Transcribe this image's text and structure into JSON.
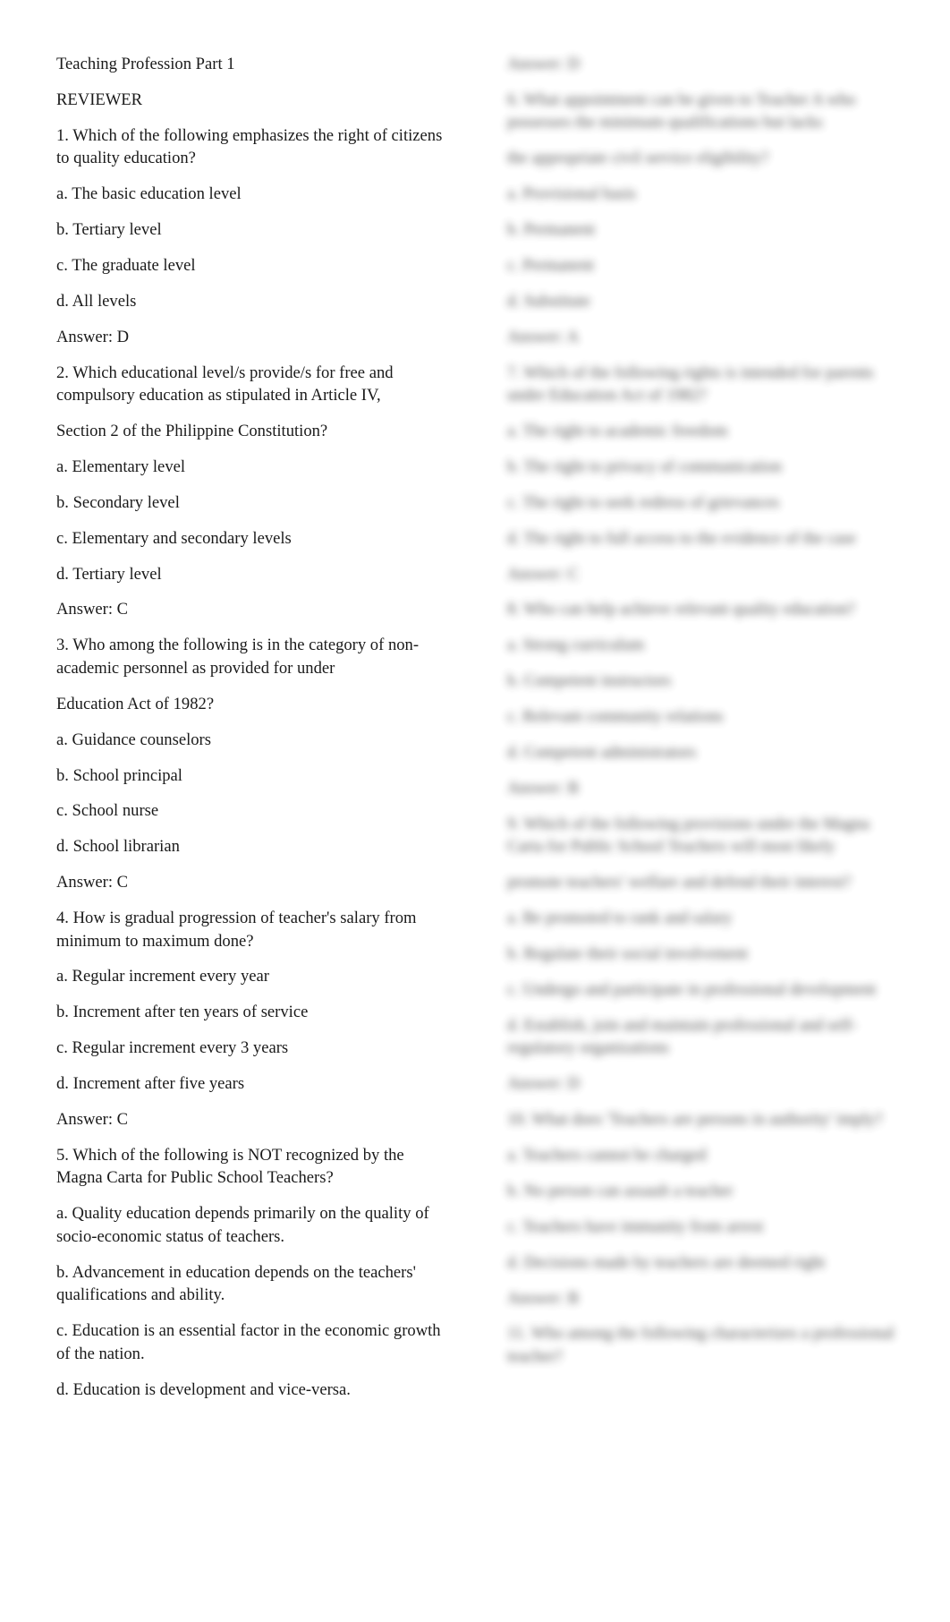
{
  "document": {
    "title": "Teaching Profession Part 1",
    "subtitle": "REVIEWER",
    "questions": [
      {
        "number": 1,
        "stem": "1. Which of the following emphasizes the right of citizens to quality education?",
        "choices": [
          "a. The basic education level",
          "b. Tertiary level",
          "c. The graduate level",
          "d. All levels"
        ],
        "answer": "Answer: D"
      },
      {
        "number": 2,
        "stem": "2. Which educational level/s provide/s for free and compulsory education as stipulated in Article IV,",
        "stem_continued": "Section 2 of the Philippine Constitution?",
        "choices": [
          "a. Elementary level",
          "b. Secondary level",
          "c. Elementary and secondary levels",
          "d. Tertiary level"
        ],
        "answer": "Answer: C"
      },
      {
        "number": 3,
        "stem": "3. Who among the following is in the category of non-academic personnel as provided for under",
        "stem_continued": "Education Act of 1982?",
        "choices": [
          "a. Guidance counselors",
          "b. School principal",
          "c. School nurse",
          "d. School librarian"
        ],
        "answer": "Answer: C"
      },
      {
        "number": 4,
        "stem": "4. How is gradual progression of teacher's salary from minimum to maximum done?",
        "choices": [
          "a. Regular increment every year",
          "b. Increment after ten years of service",
          "c. Regular increment every 3 years",
          "d. Increment after five years"
        ],
        "answer": "Answer: C"
      },
      {
        "number": 5,
        "stem": "5. Which of the following is NOT recognized by the Magna Carta for Public School Teachers?",
        "choices": [
          "a. Quality education depends primarily on the quality of socio-economic status of teachers.",
          "b. Advancement in education depends on the teachers' qualifications and ability.",
          "c. Education is an essential factor in the economic growth of the nation.",
          "d. Education is development and vice-versa."
        ]
      }
    ]
  },
  "blurred_preview": {
    "note": "Right column content is blurred (unreadable preview); lines are placeholders approximating the blurred text shapes",
    "lines": [
      "Answer: D",
      "6. What appointment can be given to Teacher A who possesses the minimum qualifications but lacks",
      "the appropriate civil service eligibility?",
      "a. Provisional basis",
      "b. Permanent",
      "c. Permanent",
      "d. Substitute",
      "Answer: A",
      "7. Which of the following rights is intended for parents under Education Act of 1982?",
      "a. The right to academic freedom",
      "b. The right to privacy of communication",
      "c. The right to seek redress of grievances",
      "d. The right to full access to the evidence of the case",
      "Answer: C",
      "8. Who can help achieve relevant quality education?",
      "a. Strong curriculum",
      "b. Competent instructors",
      "c. Relevant community relations",
      "d. Competent administrators",
      "Answer: B",
      "9. Which of the following provisions under the Magna Carta for Public School Teachers will most likely",
      "promote teachers' welfare and defend their interest?",
      "a. Be promoted to rank and salary",
      "b. Regulate their social involvement",
      "c. Undergo and participate in professional development",
      "d. Establish, join and maintain professional and self-regulatory organizations",
      "Answer: D",
      "10. What does 'Teachers are persons in authority' imply?",
      "a. Teachers cannot be charged",
      "b. No person can assault a teacher",
      "c. Teachers have immunity from arrest",
      "d. Decisions made by teachers are deemed right",
      "Answer: B",
      "11. Who among the following characterizes a professional teacher?"
    ]
  }
}
